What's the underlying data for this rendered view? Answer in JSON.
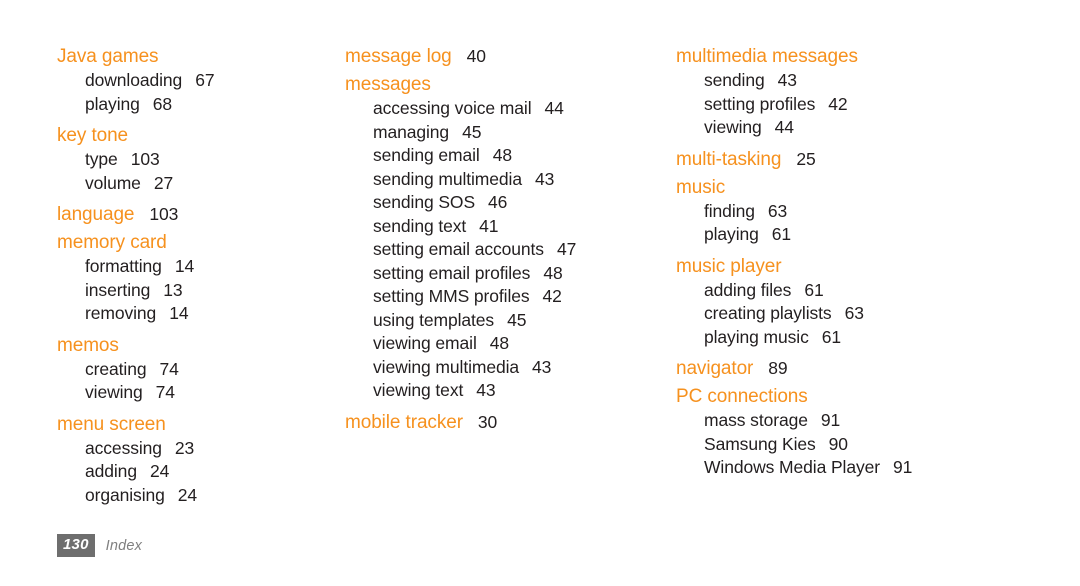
{
  "document": {
    "type": "index-page",
    "footer": {
      "page_number": "130",
      "section_label": "Index",
      "page_box_color": "#6e6e6e",
      "label_color": "#808080"
    },
    "accent_color": "#f6911e",
    "text_color": "#231f20"
  },
  "columns": [
    {
      "id": "column-1",
      "groups": [
        {
          "heading": "Java games",
          "heading_page": "",
          "subentries": [
            {
              "label": "downloading",
              "page": "67"
            },
            {
              "label": "playing",
              "page": "68"
            }
          ]
        },
        {
          "heading": "key tone",
          "heading_page": "",
          "subentries": [
            {
              "label": "type",
              "page": "103"
            },
            {
              "label": "volume",
              "page": "27"
            }
          ]
        },
        {
          "heading": "language",
          "heading_page": "103",
          "subentries": []
        },
        {
          "heading": "memory card",
          "heading_page": "",
          "subentries": [
            {
              "label": "formatting",
              "page": "14"
            },
            {
              "label": "inserting",
              "page": "13"
            },
            {
              "label": "removing",
              "page": "14"
            }
          ]
        },
        {
          "heading": "memos",
          "heading_page": "",
          "subentries": [
            {
              "label": "creating",
              "page": "74"
            },
            {
              "label": "viewing",
              "page": "74"
            }
          ]
        },
        {
          "heading": "menu screen",
          "heading_page": "",
          "subentries": [
            {
              "label": "accessing",
              "page": "23"
            },
            {
              "label": "adding",
              "page": "24"
            },
            {
              "label": "organising",
              "page": "24"
            }
          ]
        }
      ]
    },
    {
      "id": "column-2",
      "groups": [
        {
          "heading": "message log",
          "heading_page": "40",
          "subentries": []
        },
        {
          "heading": "messages",
          "heading_page": "",
          "subentries": [
            {
              "label": "accessing voice mail",
              "page": "44"
            },
            {
              "label": "managing",
              "page": "45"
            },
            {
              "label": "sending email",
              "page": "48"
            },
            {
              "label": "sending multimedia",
              "page": "43"
            },
            {
              "label": "sending SOS",
              "page": "46"
            },
            {
              "label": "sending text",
              "page": "41"
            },
            {
              "label": "setting email accounts",
              "page": "47"
            },
            {
              "label": "setting email profiles",
              "page": "48"
            },
            {
              "label": "setting MMS profiles",
              "page": "42"
            },
            {
              "label": "using templates",
              "page": "45"
            },
            {
              "label": "viewing email",
              "page": "48"
            },
            {
              "label": "viewing multimedia",
              "page": "43"
            },
            {
              "label": "viewing text",
              "page": "43"
            }
          ]
        },
        {
          "heading": "mobile tracker",
          "heading_page": "30",
          "subentries": []
        }
      ]
    },
    {
      "id": "column-3",
      "groups": [
        {
          "heading": "multimedia messages",
          "heading_page": "",
          "subentries": [
            {
              "label": "sending",
              "page": "43"
            },
            {
              "label": "setting profiles",
              "page": "42"
            },
            {
              "label": "viewing",
              "page": "44"
            }
          ]
        },
        {
          "heading": "multi-tasking",
          "heading_page": "25",
          "subentries": []
        },
        {
          "heading": "music",
          "heading_page": "",
          "subentries": [
            {
              "label": "finding",
              "page": "63"
            },
            {
              "label": "playing",
              "page": "61"
            }
          ]
        },
        {
          "heading": "music player",
          "heading_page": "",
          "subentries": [
            {
              "label": "adding files",
              "page": "61"
            },
            {
              "label": "creating playlists",
              "page": "63"
            },
            {
              "label": "playing music",
              "page": "61"
            }
          ]
        },
        {
          "heading": "navigator",
          "heading_page": "89",
          "subentries": []
        },
        {
          "heading": "PC connections",
          "heading_page": "",
          "subentries": [
            {
              "label": "mass storage",
              "page": "91"
            },
            {
              "label": "Samsung Kies",
              "page": "90"
            },
            {
              "label": "Windows Media Player",
              "page": "91"
            }
          ]
        }
      ]
    }
  ]
}
